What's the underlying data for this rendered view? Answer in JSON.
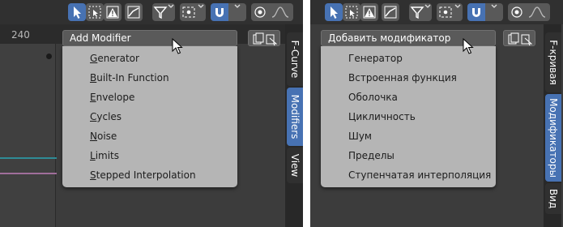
{
  "colors": {
    "accent": "#4772b3",
    "menu_bg": "#b5b5b5",
    "header_bg": "#303030",
    "editor_bg": "#3c3c3c"
  },
  "toolbar": {
    "icons": [
      "select-cursor-icon",
      "box-select-icon",
      "warning-icon",
      "normalize-graph-icon",
      "filter-funnel-icon",
      "pivot-point-icon",
      "snap-magnet-icon",
      "proportional-edit-icon",
      "falloff-curve-icon"
    ]
  },
  "english": {
    "ruler_label": "240",
    "menu_title": "Add Modifier",
    "items": [
      {
        "pre": "",
        "u": "G",
        "post": "enerator"
      },
      {
        "pre": "",
        "u": "B",
        "post": "uilt-In Function"
      },
      {
        "pre": "",
        "u": "E",
        "post": "nvelope"
      },
      {
        "pre": "",
        "u": "C",
        "post": "ycles"
      },
      {
        "pre": "",
        "u": "N",
        "post": "oise"
      },
      {
        "pre": "",
        "u": "L",
        "post": "imits"
      },
      {
        "pre": "",
        "u": "S",
        "post": "tepped Interpolation"
      }
    ],
    "tabs": [
      "F-Curve",
      "Modifiers",
      "View"
    ]
  },
  "russian": {
    "menu_title": "Добавить модификатор",
    "items": [
      "Генератор",
      "Встроенная функция",
      "Оболочка",
      "Цикличность",
      "Шум",
      "Пределы",
      "Ступенчатая интерполяция"
    ],
    "tabs": [
      "F-кривая",
      "Модификаторы",
      "Вид"
    ]
  }
}
